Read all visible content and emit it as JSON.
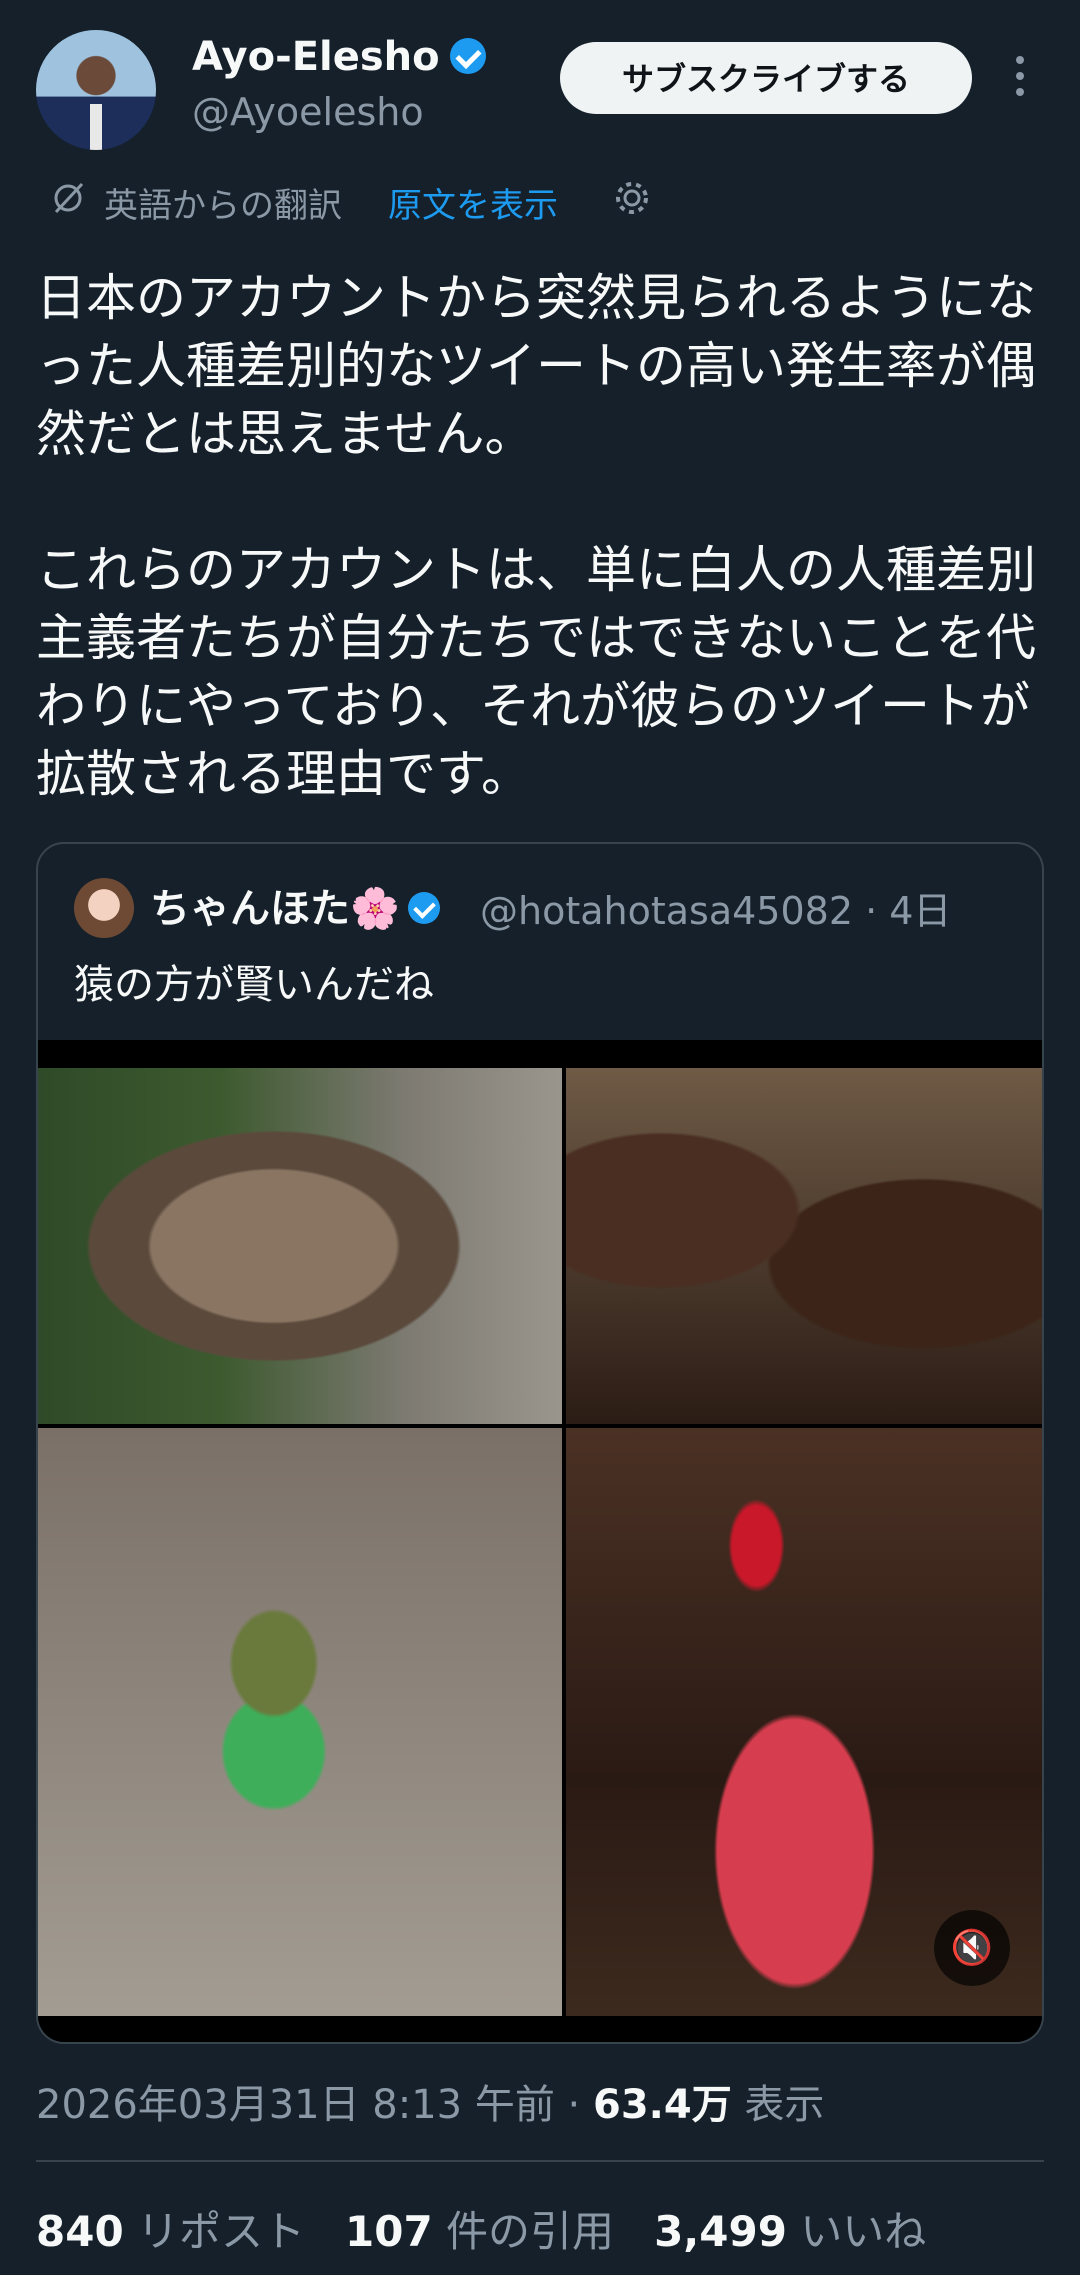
{
  "author": {
    "name": "Ayo-Elesho",
    "handle": "@Ayoelesho",
    "verified": true,
    "subscribe_label": "サブスクライブする"
  },
  "translation": {
    "label": "英語からの翻訳",
    "show_original": "原文を表示"
  },
  "tweet": {
    "paragraphs": [
      "日本のアカウントから突然見られるようになった人種差別的なツイートの高い発生率が偶然だとは思えません。",
      "これらのアカウントは、単に白人の人種差別主義者たちが自分たちではできないことを代わりにやっており、それが彼らのツイートが拡散される理由です。"
    ]
  },
  "quote": {
    "name": "ちゃんほた",
    "name_emoji": "🌸",
    "handle_time": "@hotahotasa45082 · 4日",
    "text": "猿の方が賢いんだね",
    "mute_icon": "speaker-muted-icon"
  },
  "meta": {
    "timestamp": "2026年03月31日 8:13 午前 · ",
    "views_count": "63.4万",
    "views_label": " 表示"
  },
  "stats": {
    "reposts_count": "840",
    "reposts_label": " リポスト",
    "quotes_count": "107",
    "quotes_label": " 件の引用",
    "likes_count": "3,499",
    "likes_label": " いいね"
  },
  "colors": {
    "background": "#15202b",
    "accent": "#1d9bf0",
    "muted_text": "#8b98a5"
  }
}
